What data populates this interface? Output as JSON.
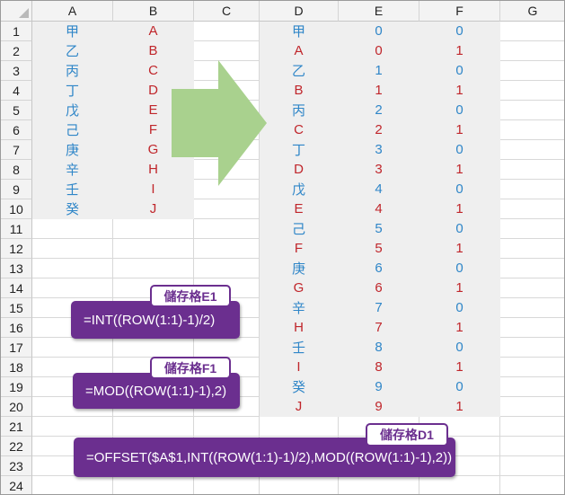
{
  "columns": [
    "A",
    "B",
    "C",
    "D",
    "E",
    "F",
    "G"
  ],
  "rows": [
    "1",
    "2",
    "3",
    "4",
    "5",
    "6",
    "7",
    "8",
    "9",
    "10",
    "11",
    "12",
    "13",
    "14",
    "15",
    "16",
    "17",
    "18",
    "19",
    "20",
    "21",
    "22",
    "23",
    "24"
  ],
  "col_a": [
    "甲",
    "乙",
    "丙",
    "丁",
    "戊",
    "己",
    "庚",
    "辛",
    "壬",
    "癸"
  ],
  "col_b": [
    "A",
    "B",
    "C",
    "D",
    "E",
    "F",
    "G",
    "H",
    "I",
    "J"
  ],
  "col_d": [
    "甲",
    "A",
    "乙",
    "B",
    "丙",
    "C",
    "丁",
    "D",
    "戊",
    "E",
    "己",
    "F",
    "庚",
    "G",
    "辛",
    "H",
    "壬",
    "I",
    "癸",
    "J"
  ],
  "col_e": [
    "0",
    "0",
    "1",
    "1",
    "2",
    "2",
    "3",
    "3",
    "4",
    "4",
    "5",
    "5",
    "6",
    "6",
    "7",
    "7",
    "8",
    "8",
    "9",
    "9"
  ],
  "col_f": [
    "0",
    "1",
    "0",
    "1",
    "0",
    "1",
    "0",
    "1",
    "0",
    "1",
    "0",
    "1",
    "0",
    "1",
    "0",
    "1",
    "0",
    "1",
    "0",
    "1"
  ],
  "callouts": {
    "e1": {
      "tag": "儲存格E1",
      "formula": "=INT((ROW(1:1)-1)/2)"
    },
    "f1": {
      "tag": "儲存格F1",
      "formula": "=MOD((ROW(1:1)-1),2)"
    },
    "d1": {
      "tag": "儲存格D1",
      "formula": "=OFFSET($A$1,INT((ROW(1:1)-1)/2),MOD((ROW(1:1)-1),2))"
    }
  },
  "colors": {
    "accent": "#6b2f8f",
    "blue_text": "#2f86c8",
    "red_text": "#c0262b",
    "arrow": "#a9d18e",
    "shade": "#efefef"
  }
}
